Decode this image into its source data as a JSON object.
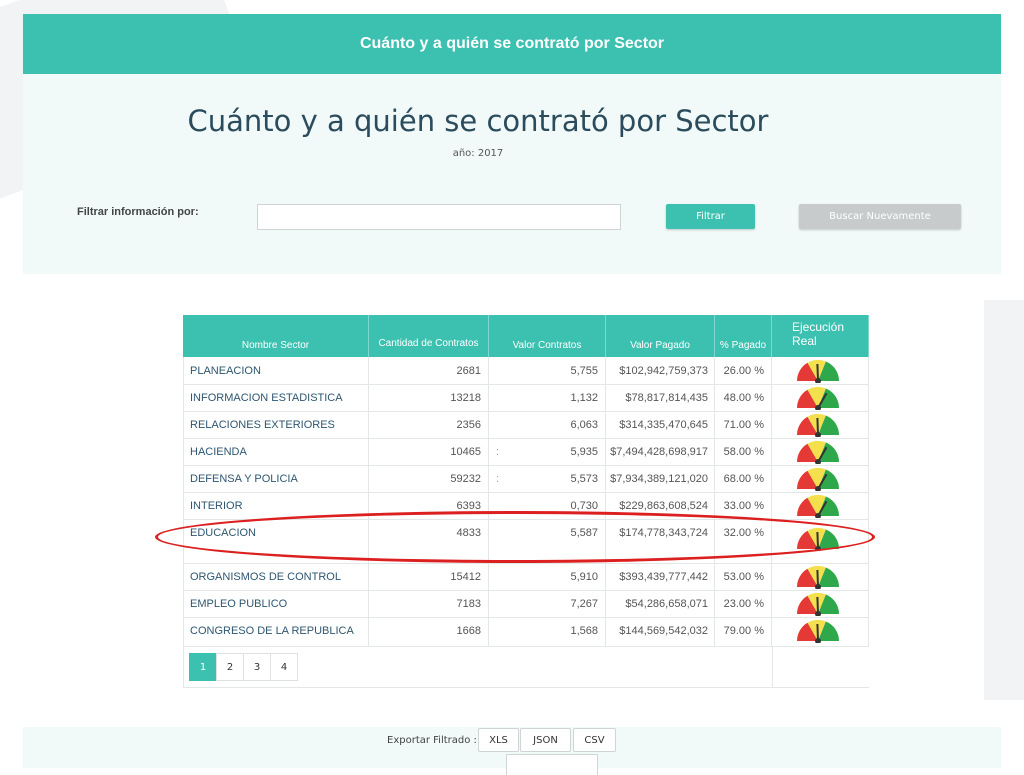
{
  "header": {
    "title": "Cuánto y a quién se contrató por Sector"
  },
  "hero": {
    "title": "Cuánto y a quién se contrató por Sector",
    "year": "año: 2017",
    "filter_label": "Filtrar información por:",
    "filter_value": "",
    "filter_button": "Filtrar",
    "search_again_button": "Buscar Nuevamente"
  },
  "table": {
    "headers": [
      "Nombre Sector",
      "Cantidad de Contratos",
      "Valor Contratos",
      "Valor Pagado",
      "% Pagado",
      "Ejecución Real"
    ],
    "rows": [
      {
        "name": "PLANEACION",
        "cantidad": "2681",
        "valor_contratos": "5,755",
        "valor_pagado": "$102,942,759,373",
        "pct": "26.00 %",
        "gauge": "yellow"
      },
      {
        "name": "INFORMACION ESTADISTICA",
        "cantidad": "13218",
        "valor_contratos": "1,132",
        "valor_pagado": "$78,817,814,435",
        "pct": "48.00 %",
        "gauge": "green"
      },
      {
        "name": "RELACIONES EXTERIORES",
        "cantidad": "2356",
        "valor_contratos": "6,063",
        "valor_pagado": "$314,335,470,645",
        "pct": "71.00 %",
        "gauge": "yellow"
      },
      {
        "name": "HACIENDA",
        "cantidad": "10465",
        "colon": ":",
        "valor_contratos": "5,935",
        "valor_pagado": "$7,494,428,698,917",
        "pct": "58.00 %",
        "gauge": "green"
      },
      {
        "name": "DEFENSA Y POLICIA",
        "cantidad": "59232",
        "colon": ":",
        "valor_contratos": "5,573",
        "valor_pagado": "$7,934,389,121,020",
        "pct": "68.00 %",
        "gauge": "green"
      },
      {
        "name": "INTERIOR",
        "cantidad": "6393",
        "valor_contratos": "0,730",
        "valor_pagado": "$229,863,608,524",
        "pct": "33.00 %",
        "gauge": "green"
      },
      {
        "name": "EDUCACION",
        "cantidad": "4833",
        "valor_contratos": "5,587",
        "valor_pagado": "$174,778,343,724",
        "pct": "32.00 %",
        "gauge": "yellow"
      },
      {
        "name": "ORGANISMOS DE CONTROL",
        "cantidad": "15412",
        "valor_contratos": "5,910",
        "valor_pagado": "$393,439,777,442",
        "pct": "53.00 %",
        "gauge": "yellow"
      },
      {
        "name": "EMPLEO PUBLICO",
        "cantidad": "7183",
        "valor_contratos": "7,267",
        "valor_pagado": "$54,286,658,071",
        "pct": "23.00 %",
        "gauge": "yellow"
      },
      {
        "name": "CONGRESO DE LA REPUBLICA",
        "cantidad": "1668",
        "valor_contratos": "1,568",
        "valor_pagado": "$144,569,542,032",
        "pct": "79.00 %",
        "gauge": "yellow"
      }
    ],
    "pagination": [
      "1",
      "2",
      "3",
      "4"
    ],
    "active_page": "1"
  },
  "footer": {
    "export_label": "Exportar Filtrado :",
    "buttons": [
      "XLS",
      "JSON",
      "CSV"
    ]
  },
  "colors": {
    "brand": "#3cc1b1",
    "highlight": "#dc1f1f"
  }
}
